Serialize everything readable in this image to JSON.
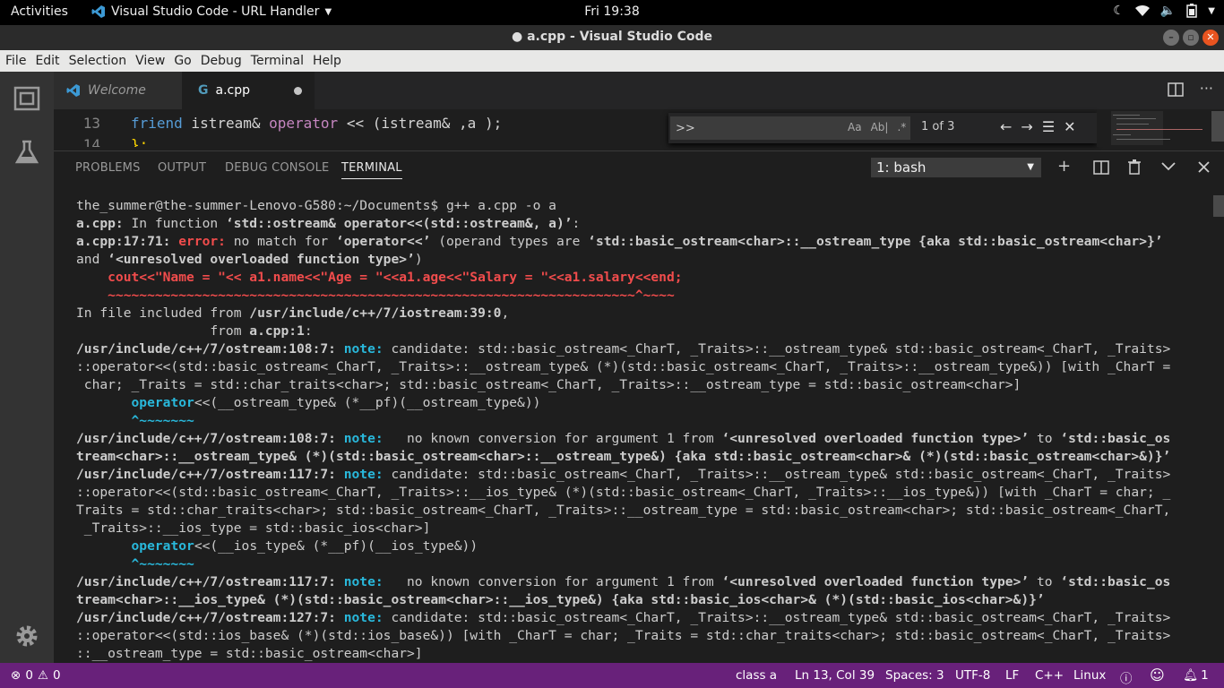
{
  "topbar": {
    "activities": "Activities",
    "app_menu": "Visual Studio Code - URL Handler",
    "clock": "Fri 19:38"
  },
  "window": {
    "title": "● a.cpp - Visual Studio Code"
  },
  "menu": [
    "File",
    "Edit",
    "Selection",
    "View",
    "Go",
    "Debug",
    "Terminal",
    "Help"
  ],
  "tabs": [
    {
      "label": "Welcome",
      "active": false
    },
    {
      "label": "a.cpp",
      "active": true,
      "modified": true,
      "icon_text": "G"
    }
  ],
  "editor": {
    "line13_num": "13",
    "line14_num": "14",
    "line13_kw": "friend",
    "line13_a": " istream& ",
    "line13_op": "operator",
    "line13_b": " << (istream& ,a );",
    "line14_text": "};"
  },
  "find": {
    "value": ">>",
    "opt_case": "Aa",
    "opt_word": "Ab|",
    "opt_regex": ".*",
    "count": "1 of 3"
  },
  "panel": {
    "tabs": [
      "PROBLEMS",
      "OUTPUT",
      "DEBUG CONSOLE",
      "TERMINAL"
    ],
    "active_tab": "TERMINAL",
    "terminal_select": "1: bash"
  },
  "terminal": {
    "l1": "the_summer@the-summer-Lenovo-G580:~/Documents$ g++ a.cpp -o a",
    "l2a": "a.cpp:",
    "l2b": " In function ",
    "l2c": "‘std::ostream& operator<<(std::ostream&, a)’",
    "l2d": ":",
    "l3a": "a.cpp:17:71: ",
    "l3b": "error: ",
    "l3c": "no match for ",
    "l3d": "‘operator<<’",
    "l3e": " (operand types are ",
    "l3f": "‘std::basic_ostream<char>::__ostream_type {aka std::basic_ostream<char>}’",
    "l4a": "and ",
    "l4b": "‘<unresolved overloaded function type>’",
    "l4c": ")",
    "l5": "    cout<<\"Name = \"<< a1.name<<\"Age = \"<<a1.age<<\"Salary = \"<<a1.salary<<end;",
    "l6": "    ~~~~~~~~~~~~~~~~~~~~~~~~~~~~~~~~~~~~~~~~~~~~~~~~~~~~~~~~~~~~~~~~~~~^~~~~",
    "l7a": "In file included from ",
    "l7b": "/usr/include/c++/7/iostream:39:0",
    "l7c": ",",
    "l8a": "                 from ",
    "l8b": "a.cpp:1",
    "l8c": ":",
    "l9a": "/usr/include/c++/7/ostream:108:7: ",
    "l9b": "note: ",
    "l9c": "candidate: std::basic_ostream<_CharT, _Traits>::__ostream_type& std::basic_ostream<_CharT, _Traits>",
    "l10": "::operator<<(std::basic_ostream<_CharT, _Traits>::__ostream_type& (*)(std::basic_ostream<_CharT, _Traits>::__ostream_type&)) [with _CharT =",
    "l11": " char; _Traits = std::char_traits<char>; std::basic_ostream<_CharT, _Traits>::__ostream_type = std::basic_ostream<char>]",
    "l12a": "       ",
    "l12b": "operator",
    "l12c": "<<(__ostream_type& (*__pf)(__ostream_type&))",
    "l13": "       ^~~~~~~~",
    "l14a": "/usr/include/c++/7/ostream:108:7: ",
    "l14b": "note: ",
    "l14c": "  no known conversion for argument 1 from ",
    "l14d": "‘<unresolved overloaded function type>’",
    "l14e": " to ",
    "l14f": "‘std::basic_os",
    "l15": "tream<char>::__ostream_type& (*)(std::basic_ostream<char>::__ostream_type&) {aka std::basic_ostream<char>& (*)(std::basic_ostream<char>&)}’",
    "l16a": "/usr/include/c++/7/ostream:117:7: ",
    "l16b": "note: ",
    "l16c": "candidate: std::basic_ostream<_CharT, _Traits>::__ostream_type& std::basic_ostream<_CharT, _Traits>",
    "l17": "::operator<<(std::basic_ostream<_CharT, _Traits>::__ios_type& (*)(std::basic_ostream<_CharT, _Traits>::__ios_type&)) [with _CharT = char; _",
    "l18": "Traits = std::char_traits<char>; std::basic_ostream<_CharT, _Traits>::__ostream_type = std::basic_ostream<char>; std::basic_ostream<_CharT,",
    "l19": " _Traits>::__ios_type = std::basic_ios<char>]",
    "l20a": "       ",
    "l20b": "operator",
    "l20c": "<<(__ios_type& (*__pf)(__ios_type&))",
    "l21": "       ^~~~~~~~",
    "l22a": "/usr/include/c++/7/ostream:117:7: ",
    "l22b": "note: ",
    "l22c": "  no known conversion for argument 1 from ",
    "l22d": "‘<unresolved overloaded function type>’",
    "l22e": " to ",
    "l22f": "‘std::basic_os",
    "l23": "tream<char>::__ios_type& (*)(std::basic_ostream<char>::__ios_type&) {aka std::basic_ios<char>& (*)(std::basic_ios<char>&)}’",
    "l24a": "/usr/include/c++/7/ostream:127:7: ",
    "l24b": "note: ",
    "l24c": "candidate: std::basic_ostream<_CharT, _Traits>::__ostream_type& std::basic_ostream<_CharT, _Traits>",
    "l25": "::operator<<(std::ios_base& (*)(std::ios_base&)) [with _CharT = char; _Traits = std::char_traits<char>; std::basic_ostream<_CharT, _Traits>",
    "l26": "::__ostream_type = std::basic_ostream<char>]"
  },
  "status": {
    "errors": "0",
    "warnings": "0",
    "scope": "class a",
    "position": "Ln 13, Col 39",
    "spaces": "Spaces: 3",
    "encoding": "UTF-8",
    "eol": "LF",
    "language": "C++",
    "os": "Linux",
    "notifications": "1"
  },
  "colors": {
    "statusbar": "#68217a",
    "error": "#f14c4c",
    "note": "#29b8db",
    "ubuntu_orange": "#e95420"
  }
}
